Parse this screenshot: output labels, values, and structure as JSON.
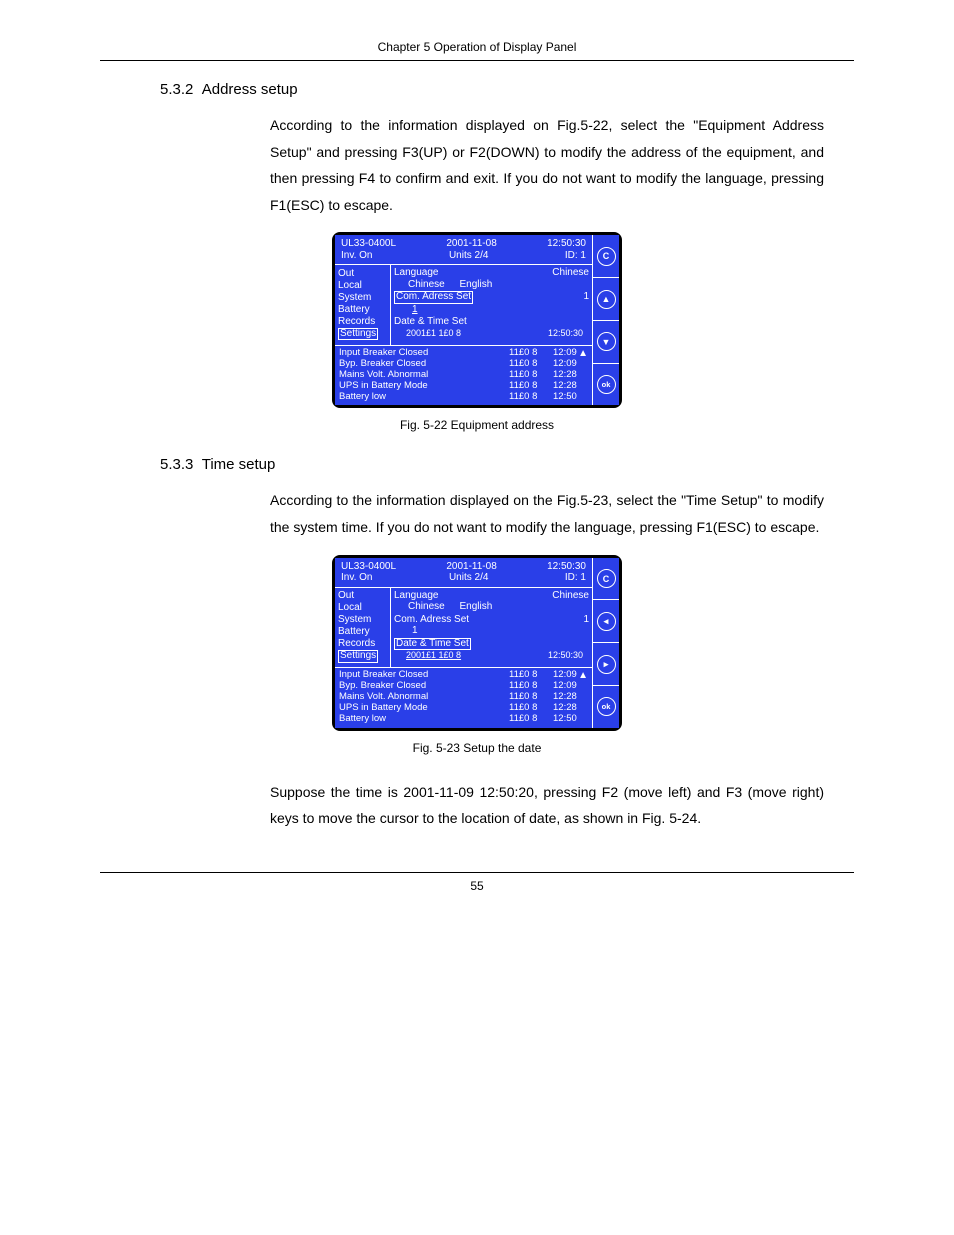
{
  "header": {
    "chapter": "Chapter 5  Operation of Display Panel"
  },
  "section1": {
    "num": "5.3.2",
    "title": "Address setup",
    "para": "According to the information displayed on Fig.5-22, select the \"Equipment Address Setup\" and pressing F3(UP) or F2(DOWN) to modify the address of the equipment, and then pressing F4 to confirm and exit. If you do not want to modify the language, pressing F1(ESC) to escape."
  },
  "section2": {
    "num": "5.3.3",
    "title": "Time setup",
    "para1": "According to the information displayed on the Fig.5-23, select the \"Time Setup\" to modify the system time. If you do not want to modify the language, pressing F1(ESC) to escape.",
    "para2": "Suppose the time is 2001-11-09 12:50:20, pressing F2 (move left) and F3 (move right) keys to move the cursor to the location of date, as shown in Fig. 5-24."
  },
  "captions": {
    "fig22": "Fig. 5-22  Equipment address",
    "fig23": "Fig. 5-23  Setup the date"
  },
  "panel": {
    "model": "UL33-0400L",
    "date": "2001-11-08",
    "time": "12:50:30",
    "status": "Inv. On",
    "units": "Units  2/4",
    "id": "ID: 1",
    "menu": [
      "Out",
      "Local",
      "System",
      "Battery",
      "Records",
      "Settings"
    ],
    "lang_label": "Language",
    "lang_current": "Chinese",
    "lang_opt1": "Chinese",
    "lang_opt2": "English",
    "addr_label": "Com. Adress Set",
    "addr_value": "1",
    "dt_label": "Date & Time Set",
    "dt_date": "2001£­1 1£­0 8",
    "dt_time": "12:50:30",
    "events": [
      {
        "label": "Input Breaker Closed",
        "date": "11£­0 8",
        "time": "12:09"
      },
      {
        "label": "Byp. Breaker Closed",
        "date": "11£­0 8",
        "time": "12:09"
      },
      {
        "label": "Mains Volt. Abnormal",
        "date": "11£­0 8",
        "time": "12:28"
      },
      {
        "label": "UPS in Battery Mode",
        "date": "11£­0 8",
        "time": "12:28"
      },
      {
        "label": "Battery low",
        "date": "11£­0 8",
        "time": "12:50"
      }
    ],
    "btn_c": "C",
    "btn_ok": "ok"
  },
  "page": "55"
}
